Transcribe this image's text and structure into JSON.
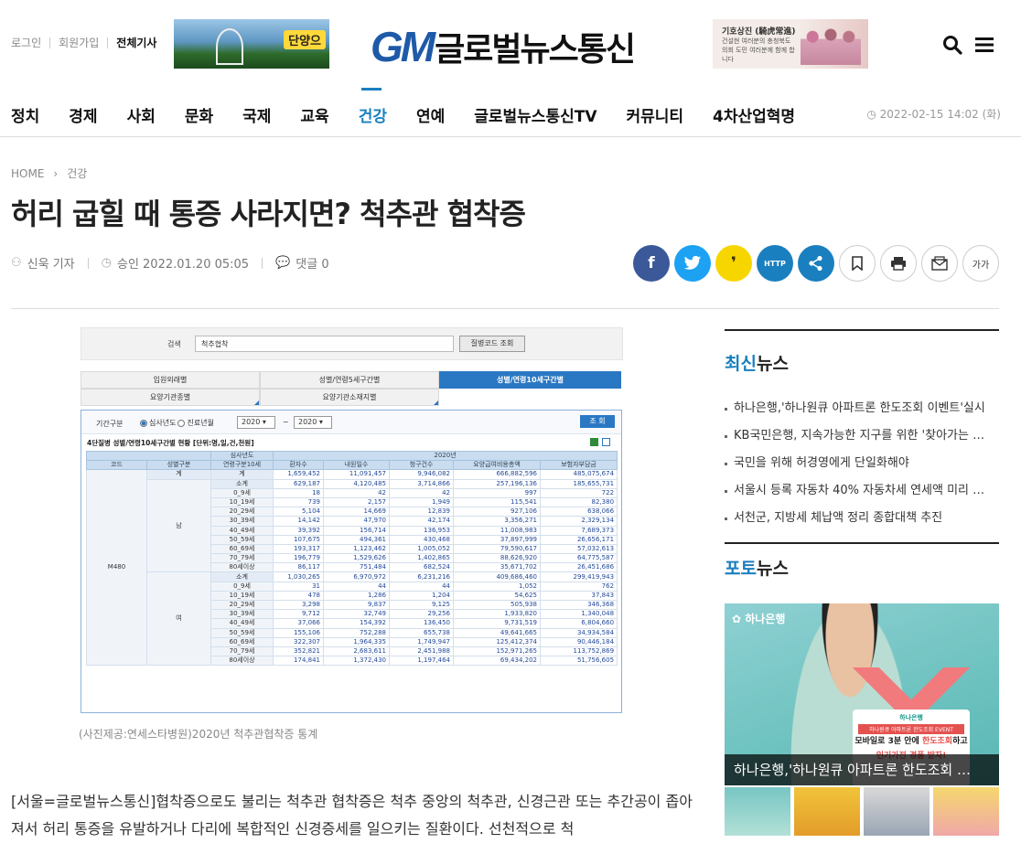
{
  "header": {
    "links": [
      "로그인",
      "회원가입",
      "전체기사"
    ],
    "ad_left_badge": "단양으",
    "logo_mark": "GM",
    "logo_name": "글로벌뉴스통신",
    "ad_right_title": "기호상진 (騎虎常進)",
    "ad_right_text": "건설현 여러분의 충청북도의회 도민 여러분께 함께 합니다",
    "menu": [
      "정치",
      "경제",
      "사회",
      "문화",
      "국제",
      "교육",
      "건강",
      "연예",
      "글로벌뉴스통신TV",
      "커뮤니티",
      "4차산업혁명"
    ],
    "active_menu": "건강",
    "date": "2022-02-15 14:02 (화)"
  },
  "article": {
    "breadcrumb_home": "HOME",
    "breadcrumb_section": "건강",
    "title": "허리 굽힐 때 통증 사라지면? 척추관 협착증",
    "author": "신욱 기자",
    "approved": "승인 2022.01.20 05:05",
    "comments": "댓글 0",
    "caption": "(사진제공:연세스타병원)2020년 척추관협착증 통계",
    "body": "[서울=글로벌뉴스통신]협착증으로도 불리는 척추관 협착증은 척추 중앙의 척추관, 신경근관 또는 추간공이 좁아져서 허리 통증을 유발하거나 다리에 복합적인 신경증세를 일으키는 질환이다. 선천적으로 척"
  },
  "share": {
    "facebook": "f",
    "twitter": "t",
    "kakao": "❜",
    "url": "HTTP",
    "font": "가가",
    "colors": {
      "facebook": "#3b5998",
      "twitter": "#1da1f2",
      "kakao": "#f7d600",
      "url": "#1a7fbf",
      "share": "#1a7fbf"
    }
  },
  "figure": {
    "search_label": "검색",
    "search_value": "척추협착",
    "search_button": "질병코드 조회",
    "tabs": [
      "입원외래별",
      "성별/연령5세구간별",
      "성별/연령10세구간별",
      "요양기관종별",
      "요양기관소재지별"
    ],
    "period_label": "기간구분",
    "radio1": "심사년도",
    "radio2": "진료년월",
    "year_from": "2020",
    "tilde": "~",
    "year_to": "2020",
    "go_button": "조 회",
    "table_title": "4단질병 성별/연령10세구간별 현황 [단위:명,일,건,천원]",
    "h_review_year": "심사년도",
    "h_year": "2020년",
    "h_code": "코드",
    "h_gender": "성별구분",
    "h_age": "연령구분10세",
    "h_cols": [
      "환자수",
      "내원일수",
      "청구건수",
      "요양급여비용총액",
      "보험자부담금"
    ],
    "code": "M480",
    "total_label": "계",
    "male": "남",
    "female": "여",
    "total_row": [
      "1,659,452",
      "11,091,457",
      "9,946,082",
      "666,882,596",
      "485,075,674"
    ],
    "male_rows": [
      [
        "소계",
        "629,187",
        "4,120,485",
        "3,714,866",
        "257,196,136",
        "185,655,731"
      ],
      [
        "0_9세",
        "18",
        "42",
        "42",
        "997",
        "722"
      ],
      [
        "10_19세",
        "739",
        "2,157",
        "1,949",
        "115,541",
        "82,380"
      ],
      [
        "20_29세",
        "5,104",
        "14,669",
        "12,839",
        "927,106",
        "638,066"
      ],
      [
        "30_39세",
        "14,142",
        "47,970",
        "42,174",
        "3,356,271",
        "2,329,134"
      ],
      [
        "40_49세",
        "39,392",
        "156,714",
        "136,953",
        "11,008,983",
        "7,689,373"
      ],
      [
        "50_59세",
        "107,675",
        "494,361",
        "430,468",
        "37,897,999",
        "26,656,171"
      ],
      [
        "60_69세",
        "193,317",
        "1,123,462",
        "1,005,052",
        "79,590,617",
        "57,032,613"
      ],
      [
        "70_79세",
        "196,779",
        "1,529,626",
        "1,402,865",
        "88,626,920",
        "64,775,587"
      ],
      [
        "80세이상",
        "86,117",
        "751,484",
        "682,524",
        "35,671,702",
        "26,451,686"
      ]
    ],
    "female_rows": [
      [
        "소계",
        "1,030,265",
        "6,970,972",
        "6,231,216",
        "409,686,460",
        "299,419,943"
      ],
      [
        "0_9세",
        "31",
        "44",
        "44",
        "1,052",
        "762"
      ],
      [
        "10_19세",
        "478",
        "1,286",
        "1,204",
        "54,625",
        "37,843"
      ],
      [
        "20_29세",
        "3,298",
        "9,837",
        "9,125",
        "505,938",
        "346,368"
      ],
      [
        "30_39세",
        "9,712",
        "32,749",
        "29,256",
        "1,933,820",
        "1,340,048"
      ],
      [
        "40_49세",
        "37,066",
        "154,392",
        "136,450",
        "9,731,519",
        "6,804,660"
      ],
      [
        "50_59세",
        "155,106",
        "752,288",
        "655,738",
        "49,641,665",
        "34,934,584"
      ],
      [
        "60_69세",
        "322,307",
        "1,964,335",
        "1,749,947",
        "125,412,374",
        "90,446,184"
      ],
      [
        "70_79세",
        "352,821",
        "2,683,611",
        "2,451,988",
        "152,971,265",
        "113,752,869"
      ],
      [
        "80세이상",
        "174,841",
        "1,372,430",
        "1,197,464",
        "69,434,202",
        "51,756,605"
      ]
    ]
  },
  "sidebar": {
    "latest_head_accent": "최신",
    "latest_head_rest": "뉴스",
    "latest": [
      "하나은행,'하나원큐 아파트론 한도조회 이벤트'실시",
      "KB국민은행, 지속가능한 지구를 위한 '찾아가는 …",
      "국민을 위해 허경영에게 단일화해야",
      "서울시 등록 자동차 40% 자동차세 연세액 미리 …",
      "서천군, 지방세 체납액 정리 종합대책 추진"
    ],
    "photo_head_accent": "포토",
    "photo_head_rest": "뉴스",
    "photo_brand": "하나은행",
    "photo_card_brand": "하나은행",
    "photo_card_event": "하나원큐 아파트론 한도조회 EVENT",
    "photo_card_line1a": "모바일로 3분 안에 ",
    "photo_card_line1b": "한도조회",
    "photo_card_line1c": "하고",
    "photo_card_line2": "인기가전 경품 받자!",
    "photo_title": "하나은행,'하나원큐 아파트론 한도조회 …"
  }
}
